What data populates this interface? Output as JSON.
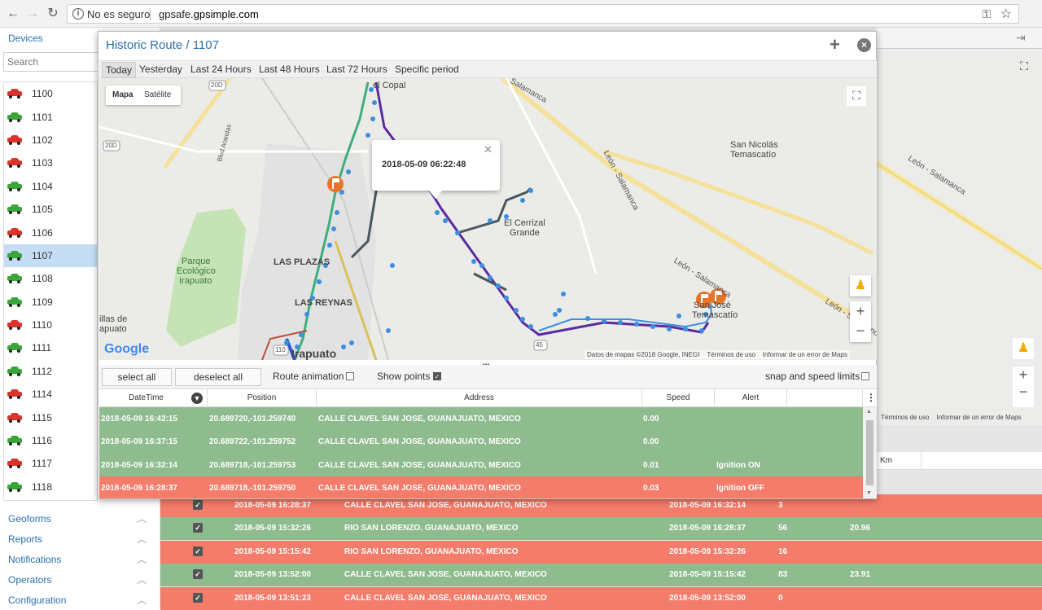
{
  "browser": {
    "security": "No es seguro",
    "url_prefix": "gpsafe.",
    "url_main": "gpsimple.com"
  },
  "sidebar": {
    "title": "Devices",
    "search_placeholder": "Search",
    "devices": [
      {
        "name": "1100",
        "status": "red"
      },
      {
        "name": "1101",
        "status": "green"
      },
      {
        "name": "1102",
        "status": "red"
      },
      {
        "name": "1103",
        "status": "red"
      },
      {
        "name": "1104",
        "status": "green"
      },
      {
        "name": "1105",
        "status": "green"
      },
      {
        "name": "1106",
        "status": "red"
      },
      {
        "name": "1107",
        "status": "green",
        "selected": true
      },
      {
        "name": "1108",
        "status": "green"
      },
      {
        "name": "1109",
        "status": "green"
      },
      {
        "name": "1110",
        "status": "red"
      },
      {
        "name": "1111",
        "status": "green"
      },
      {
        "name": "1112",
        "status": "green"
      },
      {
        "name": "1114",
        "status": "red"
      },
      {
        "name": "1115",
        "status": "red"
      },
      {
        "name": "1116",
        "status": "green"
      },
      {
        "name": "1117",
        "status": "red"
      },
      {
        "name": "1118",
        "status": "green"
      }
    ],
    "sections": [
      "Geoforms",
      "Reports",
      "Notifications",
      "Operators",
      "Configuration"
    ]
  },
  "modal": {
    "title": "Historic Route / 1107",
    "tabs": [
      "Today",
      "Yesterday",
      "Last 24 Hours",
      "Last 48 Hours",
      "Last 72 Hours",
      "Specific period"
    ],
    "active_tab": "Today",
    "map": {
      "type_map": "Mapa",
      "type_sat": "Satélite",
      "popup_time": "2018-05-09 06:22:48",
      "attribution": "Datos de mapas ©2018 Google, INEGI",
      "terms": "Términos de uso",
      "report": "Informar de un error de Maps",
      "google": "Google",
      "labels": {
        "copal": "el Copal",
        "salamanca": "Salamanca",
        "leon_salamanca_v": "León - Salamanca",
        "san_nicolas": "San Nicolás",
        "temascatio": "Temascatío",
        "leon_salamanca_r": "León - Salamanca",
        "cerrizal": "El Cerrizal",
        "grande": "Grande",
        "parque1": "Parque",
        "parque2": "Ecológico",
        "parque3": "Irapuato",
        "las_plazas": "LAS PLAZAS",
        "las_reynas": "LAS REYNAS",
        "irapuato": "Irapuato",
        "villas": "illas de",
        "irapuato2": "apuato",
        "sanjose1": "San José",
        "sanjose2": "Temascatío",
        "leon_salamanca_diag": "León - Salamanca",
        "leon_salamanca_r2": "León - Salamanca",
        "r20d": "20D",
        "r20d2": "20D",
        "r110": "110",
        "r45": "45",
        "blvd": "Blvd Arandas"
      }
    },
    "toolbar": {
      "select_all": "select all",
      "deselect_all": "deselect all",
      "route_animation": "Route animation",
      "route_animation_checked": false,
      "show_points": "Show points",
      "show_points_checked": true,
      "snap": "snap and speed limits",
      "snap_checked": false
    },
    "grid": {
      "columns": [
        "DateTime",
        "Position",
        "Address",
        "Speed",
        "Alert"
      ],
      "rows": [
        {
          "datetime": "2018-05-09 16:42:15",
          "position": "20.689720,-101.259740",
          "address": "CALLE CLAVEL SAN JOSE, GUANAJUATO, MEXICO",
          "speed": "0.00",
          "alert": "",
          "color": "green"
        },
        {
          "datetime": "2018-05-09 16:37:15",
          "position": "20.689722,-101.259752",
          "address": "CALLE CLAVEL SAN JOSE, GUANAJUATO, MEXICO",
          "speed": "0.00",
          "alert": "",
          "color": "green"
        },
        {
          "datetime": "2018-05-09 16:32:14",
          "position": "20.689718,-101.259753",
          "address": "CALLE CLAVEL SAN JOSE, GUANAJUATO, MEXICO",
          "speed": "0.01",
          "alert": "Ignition ON",
          "color": "green"
        },
        {
          "datetime": "2018-05-09 16:28:37",
          "position": "20.689718,-101.259750",
          "address": "CALLE CLAVEL SAN JOSE, GUANAJUATO, MEXICO",
          "speed": "0.03",
          "alert": "Ignition OFF",
          "color": "red"
        }
      ]
    }
  },
  "background": {
    "terms": "Términos de uso",
    "report": "Informar de un error de Maps",
    "km_header": "Km",
    "rows": [
      {
        "start": "2018-05-09 16:28:37",
        "address": "CALLE CLAVEL SAN JOSE, GUANAJUATO, MEXICO",
        "end": "2018-05-09 16:32:14",
        "minutes": "3",
        "km": "",
        "color": "red"
      },
      {
        "start": "2018-05-09 15:32:26",
        "address": "RIO SAN LORENZO, GUANAJUATO, MEXICO",
        "end": "2018-05-09 16:28:37",
        "minutes": "56",
        "km": "20.96",
        "color": "green"
      },
      {
        "start": "2018-05-09 15:15:42",
        "address": "RIO SAN LORENZO, GUANAJUATO, MEXICO",
        "end": "2018-05-09 15:32:26",
        "minutes": "16",
        "km": "",
        "color": "red"
      },
      {
        "start": "2018-05-09 13:52:00",
        "address": "CALLE CLAVEL SAN JOSE, GUANAJUATO, MEXICO",
        "end": "2018-05-09 15:15:42",
        "minutes": "83",
        "km": "23.91",
        "color": "green"
      },
      {
        "start": "2018-05-09 13:51:23",
        "address": "CALLE CLAVEL SAN JOSE, GUANAJUATO, MEXICO",
        "end": "2018-05-09 13:52:00",
        "minutes": "0",
        "km": "",
        "color": "red"
      }
    ]
  },
  "colors": {
    "green_row": "#8fbc8f",
    "red_row": "#f47c6b",
    "accent": "#2a6fb0",
    "route_blue": "#3b8fe0",
    "route_purple": "#5a2ca0"
  }
}
